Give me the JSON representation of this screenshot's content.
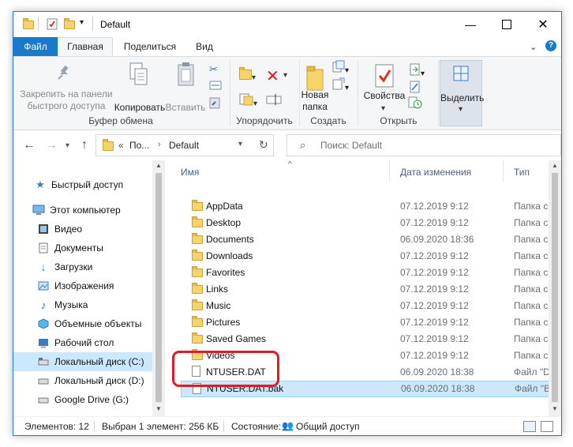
{
  "window": {
    "title": "Default",
    "controls": [
      "minimize-icon",
      "maximize-icon",
      "close-icon"
    ]
  },
  "ribbon_tabs": [
    "Файл",
    "Главная",
    "Поделиться",
    "Вид"
  ],
  "ribbon": {
    "clipboard": {
      "pin_label": "Закрепить на панели быстрого доступа",
      "copy_label": "Копировать",
      "paste_label": "Вставить",
      "group_label": "Буфер обмена"
    },
    "organize": {
      "group_label": "Упорядочить"
    },
    "create": {
      "new_folder_label": "Новая папка",
      "group_label": "Создать"
    },
    "open": {
      "properties_label": "Свойства",
      "group_label": "Открыть"
    },
    "select": {
      "select_label": "Выделить"
    }
  },
  "address": {
    "crumb_prefix": "«",
    "crumb_parent": "По...",
    "crumb_current": "Default",
    "search_placeholder": "Поиск: Default"
  },
  "nav_pane": {
    "items": [
      {
        "label": "Быстрый доступ",
        "icon": "star-icon"
      },
      {
        "label": "Этот компьютер",
        "icon": "computer-icon"
      },
      {
        "label": "Видео",
        "icon": "video-icon"
      },
      {
        "label": "Документы",
        "icon": "documents-icon"
      },
      {
        "label": "Загрузки",
        "icon": "downloads-icon"
      },
      {
        "label": "Изображения",
        "icon": "pictures-icon"
      },
      {
        "label": "Музыка",
        "icon": "music-icon"
      },
      {
        "label": "Объемные объекты",
        "icon": "3d-objects-icon"
      },
      {
        "label": "Рабочий стол",
        "icon": "desktop-icon"
      },
      {
        "label": "Локальный диск (C:)",
        "icon": "drive-icon"
      },
      {
        "label": "Локальный диск (D:)",
        "icon": "drive-icon"
      },
      {
        "label": "Google Drive (G:)",
        "icon": "drive-icon"
      }
    ]
  },
  "file_list": {
    "columns": [
      "Имя",
      "Дата изменения",
      "Тип"
    ],
    "rows": [
      {
        "name": "AppData",
        "date": "07.12.2019 9:12",
        "type": "Папка с файл",
        "kind": "folder"
      },
      {
        "name": "Desktop",
        "date": "07.12.2019 9:12",
        "type": "Папка с файл",
        "kind": "folder"
      },
      {
        "name": "Documents",
        "date": "06.09.2020 18:36",
        "type": "Папка с файл",
        "kind": "folder"
      },
      {
        "name": "Downloads",
        "date": "07.12.2019 9:12",
        "type": "Папка с файл",
        "kind": "folder"
      },
      {
        "name": "Favorites",
        "date": "07.12.2019 9:12",
        "type": "Папка с файл",
        "kind": "folder"
      },
      {
        "name": "Links",
        "date": "07.12.2019 9:12",
        "type": "Папка с файл",
        "kind": "folder"
      },
      {
        "name": "Music",
        "date": "07.12.2019 9:12",
        "type": "Папка с файл",
        "kind": "folder"
      },
      {
        "name": "Pictures",
        "date": "07.12.2019 9:12",
        "type": "Папка с файл",
        "kind": "folder"
      },
      {
        "name": "Saved Games",
        "date": "07.12.2019 9:12",
        "type": "Папка с файл",
        "kind": "folder"
      },
      {
        "name": "Videos",
        "date": "07.12.2019 9:12",
        "type": "Папка с файл",
        "kind": "folder"
      },
      {
        "name": "NTUSER.DAT",
        "date": "06.09.2020 18:38",
        "type": "Файл \"DAT\"",
        "kind": "file"
      },
      {
        "name": "NTUSER.DAT.bak",
        "date": "06.09.2020 18:38",
        "type": "Файл \"BAK\"",
        "kind": "file"
      }
    ]
  },
  "status_bar": {
    "items_count": "Элементов: 12",
    "selected": "Выбран 1 элемент: 256 КБ",
    "state": "Состояние:",
    "sharing": "Общий доступ"
  },
  "colors": {
    "accent": "#1979ca",
    "selection": "#cce8ff",
    "highlight": "#e01b24"
  }
}
